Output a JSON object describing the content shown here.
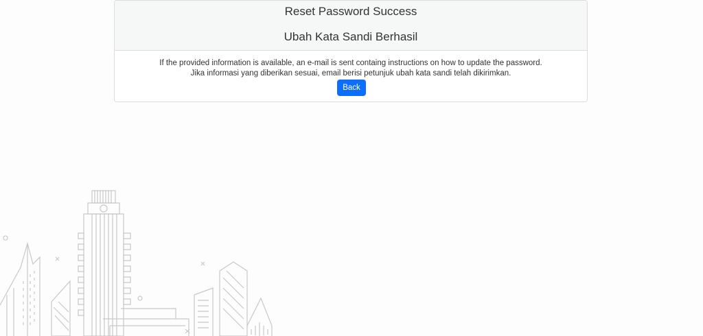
{
  "card": {
    "title_en": "Reset Password Success",
    "title_id": "Ubah Kata Sandi Berhasil",
    "message_en": "If the provided information is available, an e-mail is sent containg instructions on how to update the password.",
    "message_id": "Jika informasi yang diberikan sesuai, email berisi petunjuk ubah kata sandi telah dikirimkan.",
    "back_label": "Back"
  },
  "colors": {
    "primary": "#0d6efd",
    "header_bg": "#f6f7f7",
    "border": "#dcdcdc",
    "illustration_stroke": "#c8c8c8"
  },
  "icons": {
    "background": "city-skyline-illustration"
  }
}
